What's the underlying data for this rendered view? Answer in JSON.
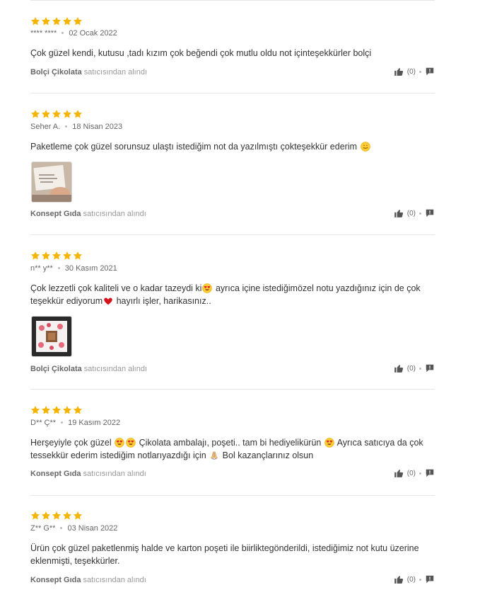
{
  "colors": {
    "star": "#F5B400",
    "divider": "#e6e6e6",
    "text": "#333333",
    "muted": "#999999"
  },
  "reviews": [
    {
      "rating": 5,
      "user": "**** ****",
      "date": "02 Ocak 2022",
      "comment": "Çok güzel kendi, kutusu ,tadı kızım çok beğendi çok mutlu oldu not içinteşekkürler bolçi",
      "has_photo": false,
      "seller_name": "Bolçi Çikolata",
      "seller_suffix": "satıcısından alındı",
      "likes": "(0)"
    },
    {
      "rating": 5,
      "user": "Seher A.",
      "date": "18 Nisan 2023",
      "comment": "Paketleme çok güzel sorunsuz ulaştı istediğim not da yazılmıştı çokteşekkür ederim",
      "has_photo": true,
      "seller_name": "Konsept Gıda",
      "seller_suffix": "satıcısından alındı",
      "likes": "(0)"
    },
    {
      "rating": 5,
      "user": "n** y**",
      "date": "30 Kasım 2021",
      "comment_parts": [
        "Çok lezzetli çok kaliteli ve o kadar tazeydi ki",
        " ayrıca içine istediğimözel notu yazdığınız için de çok teşekkür ediyorum",
        " hayırlı işler, harikasınız.."
      ],
      "has_photo": true,
      "seller_name": "Bolçi Çikolata",
      "seller_suffix": "satıcısından alındı",
      "likes": "(0)"
    },
    {
      "rating": 5,
      "user": "D** Ç**",
      "date": "19 Kasım 2022",
      "comment_parts": [
        "Herşeyiyle çok güzel ",
        " Çikolata ambalajı, poşeti.. tam bi hediyelikürün ",
        " Ayrıca satıcıya da çok tessekkür ederim istediğim notlarıyazdığı için ",
        " Bol kazançlarınız olsun"
      ],
      "has_photo": false,
      "seller_name": "Konsept Gıda",
      "seller_suffix": "satıcısından alındı",
      "likes": "(0)"
    },
    {
      "rating": 5,
      "user": "Z** G**",
      "date": "03 Nisan 2022",
      "comment": "Ürün çok güzel paketlenmiş halde ve karton poşeti ile biirliktegönderildi, istediğimiz not kutu üzerine eklenmişti, teşekkürler.",
      "has_photo": false,
      "seller_name": "Konsept Gıda",
      "seller_suffix": "satıcısından alındı",
      "likes": "(0)"
    }
  ]
}
